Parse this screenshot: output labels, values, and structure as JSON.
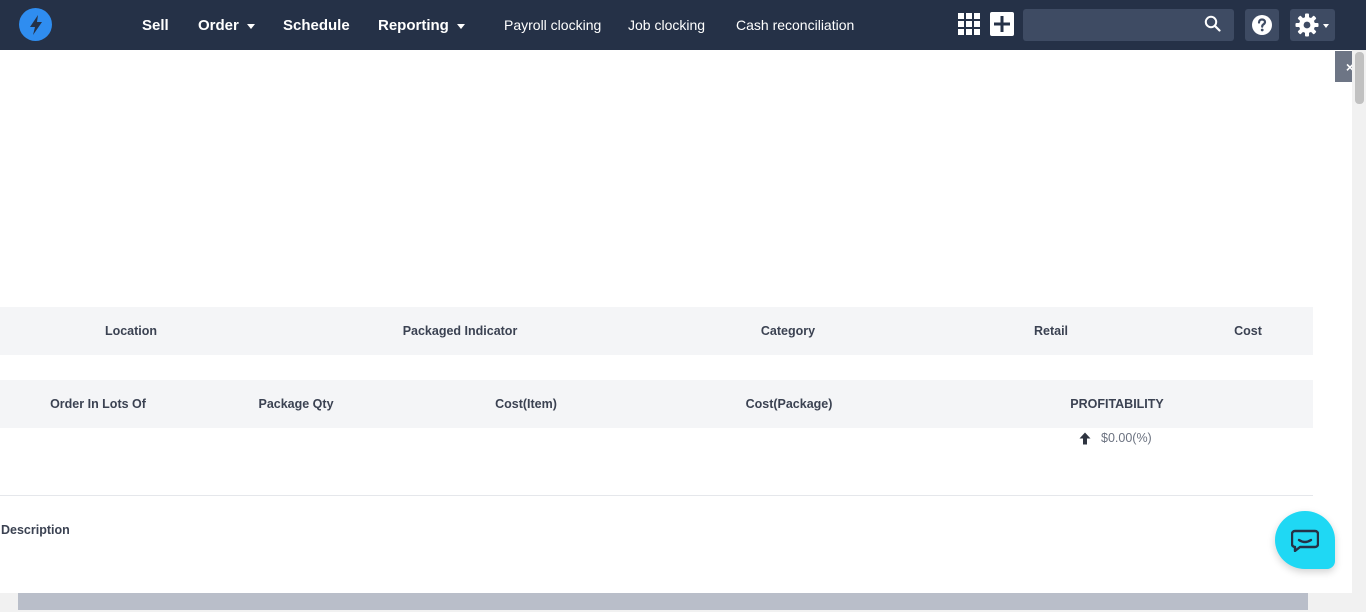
{
  "navbar": {
    "main_items": [
      {
        "label": "Sell",
        "has_dropdown": false
      },
      {
        "label": "Order",
        "has_dropdown": true
      },
      {
        "label": "Schedule",
        "has_dropdown": false
      },
      {
        "label": "Reporting",
        "has_dropdown": true
      }
    ],
    "sub_items": [
      {
        "label": "Payroll clocking"
      },
      {
        "label": "Job clocking"
      },
      {
        "label": "Cash reconciliation"
      }
    ],
    "search": {
      "value": "",
      "placeholder": ""
    },
    "icons": [
      "lightning-logo-icon",
      "apps-grid-icon",
      "plus-icon",
      "search-icon",
      "help-icon",
      "gear-icon"
    ]
  },
  "table": {
    "header_row_1": [
      "Location",
      "Packaged Indicator",
      "Category",
      "Retail",
      "Cost"
    ],
    "header_row_2": [
      "Order In Lots Of",
      "Package Qty",
      "Cost(Item)",
      "Cost(Package)",
      "PROFITABILITY"
    ],
    "profitability_value": "$0.00(%)"
  },
  "description_label": "Description",
  "side_close_glyph": "×",
  "colors": {
    "navbar": "#253147",
    "logo": "#2f8df0",
    "chat": "#1fd8f4",
    "band": "#f4f5f7"
  }
}
